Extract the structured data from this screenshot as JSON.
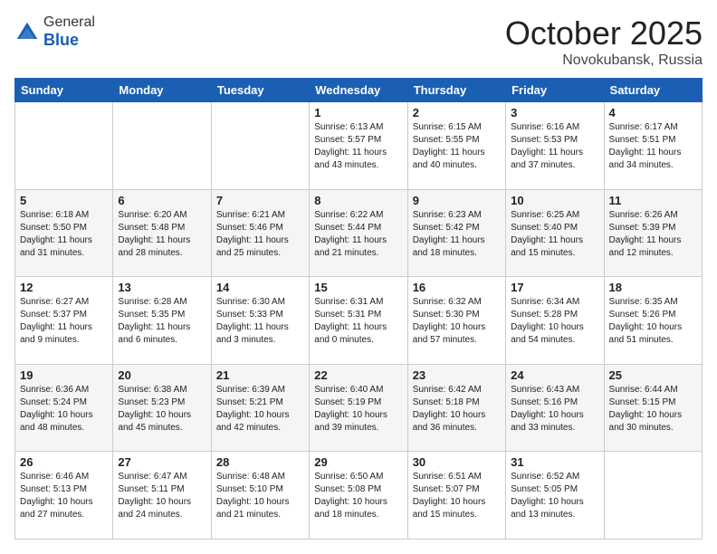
{
  "header": {
    "logo_general": "General",
    "logo_blue": "Blue",
    "month": "October 2025",
    "location": "Novokubansk, Russia"
  },
  "weekdays": [
    "Sunday",
    "Monday",
    "Tuesday",
    "Wednesday",
    "Thursday",
    "Friday",
    "Saturday"
  ],
  "weeks": [
    [
      {
        "day": "",
        "info": ""
      },
      {
        "day": "",
        "info": ""
      },
      {
        "day": "",
        "info": ""
      },
      {
        "day": "1",
        "info": "Sunrise: 6:13 AM\nSunset: 5:57 PM\nDaylight: 11 hours\nand 43 minutes."
      },
      {
        "day": "2",
        "info": "Sunrise: 6:15 AM\nSunset: 5:55 PM\nDaylight: 11 hours\nand 40 minutes."
      },
      {
        "day": "3",
        "info": "Sunrise: 6:16 AM\nSunset: 5:53 PM\nDaylight: 11 hours\nand 37 minutes."
      },
      {
        "day": "4",
        "info": "Sunrise: 6:17 AM\nSunset: 5:51 PM\nDaylight: 11 hours\nand 34 minutes."
      }
    ],
    [
      {
        "day": "5",
        "info": "Sunrise: 6:18 AM\nSunset: 5:50 PM\nDaylight: 11 hours\nand 31 minutes."
      },
      {
        "day": "6",
        "info": "Sunrise: 6:20 AM\nSunset: 5:48 PM\nDaylight: 11 hours\nand 28 minutes."
      },
      {
        "day": "7",
        "info": "Sunrise: 6:21 AM\nSunset: 5:46 PM\nDaylight: 11 hours\nand 25 minutes."
      },
      {
        "day": "8",
        "info": "Sunrise: 6:22 AM\nSunset: 5:44 PM\nDaylight: 11 hours\nand 21 minutes."
      },
      {
        "day": "9",
        "info": "Sunrise: 6:23 AM\nSunset: 5:42 PM\nDaylight: 11 hours\nand 18 minutes."
      },
      {
        "day": "10",
        "info": "Sunrise: 6:25 AM\nSunset: 5:40 PM\nDaylight: 11 hours\nand 15 minutes."
      },
      {
        "day": "11",
        "info": "Sunrise: 6:26 AM\nSunset: 5:39 PM\nDaylight: 11 hours\nand 12 minutes."
      }
    ],
    [
      {
        "day": "12",
        "info": "Sunrise: 6:27 AM\nSunset: 5:37 PM\nDaylight: 11 hours\nand 9 minutes."
      },
      {
        "day": "13",
        "info": "Sunrise: 6:28 AM\nSunset: 5:35 PM\nDaylight: 11 hours\nand 6 minutes."
      },
      {
        "day": "14",
        "info": "Sunrise: 6:30 AM\nSunset: 5:33 PM\nDaylight: 11 hours\nand 3 minutes."
      },
      {
        "day": "15",
        "info": "Sunrise: 6:31 AM\nSunset: 5:31 PM\nDaylight: 11 hours\nand 0 minutes."
      },
      {
        "day": "16",
        "info": "Sunrise: 6:32 AM\nSunset: 5:30 PM\nDaylight: 10 hours\nand 57 minutes."
      },
      {
        "day": "17",
        "info": "Sunrise: 6:34 AM\nSunset: 5:28 PM\nDaylight: 10 hours\nand 54 minutes."
      },
      {
        "day": "18",
        "info": "Sunrise: 6:35 AM\nSunset: 5:26 PM\nDaylight: 10 hours\nand 51 minutes."
      }
    ],
    [
      {
        "day": "19",
        "info": "Sunrise: 6:36 AM\nSunset: 5:24 PM\nDaylight: 10 hours\nand 48 minutes."
      },
      {
        "day": "20",
        "info": "Sunrise: 6:38 AM\nSunset: 5:23 PM\nDaylight: 10 hours\nand 45 minutes."
      },
      {
        "day": "21",
        "info": "Sunrise: 6:39 AM\nSunset: 5:21 PM\nDaylight: 10 hours\nand 42 minutes."
      },
      {
        "day": "22",
        "info": "Sunrise: 6:40 AM\nSunset: 5:19 PM\nDaylight: 10 hours\nand 39 minutes."
      },
      {
        "day": "23",
        "info": "Sunrise: 6:42 AM\nSunset: 5:18 PM\nDaylight: 10 hours\nand 36 minutes."
      },
      {
        "day": "24",
        "info": "Sunrise: 6:43 AM\nSunset: 5:16 PM\nDaylight: 10 hours\nand 33 minutes."
      },
      {
        "day": "25",
        "info": "Sunrise: 6:44 AM\nSunset: 5:15 PM\nDaylight: 10 hours\nand 30 minutes."
      }
    ],
    [
      {
        "day": "26",
        "info": "Sunrise: 6:46 AM\nSunset: 5:13 PM\nDaylight: 10 hours\nand 27 minutes."
      },
      {
        "day": "27",
        "info": "Sunrise: 6:47 AM\nSunset: 5:11 PM\nDaylight: 10 hours\nand 24 minutes."
      },
      {
        "day": "28",
        "info": "Sunrise: 6:48 AM\nSunset: 5:10 PM\nDaylight: 10 hours\nand 21 minutes."
      },
      {
        "day": "29",
        "info": "Sunrise: 6:50 AM\nSunset: 5:08 PM\nDaylight: 10 hours\nand 18 minutes."
      },
      {
        "day": "30",
        "info": "Sunrise: 6:51 AM\nSunset: 5:07 PM\nDaylight: 10 hours\nand 15 minutes."
      },
      {
        "day": "31",
        "info": "Sunrise: 6:52 AM\nSunset: 5:05 PM\nDaylight: 10 hours\nand 13 minutes."
      },
      {
        "day": "",
        "info": ""
      }
    ]
  ]
}
